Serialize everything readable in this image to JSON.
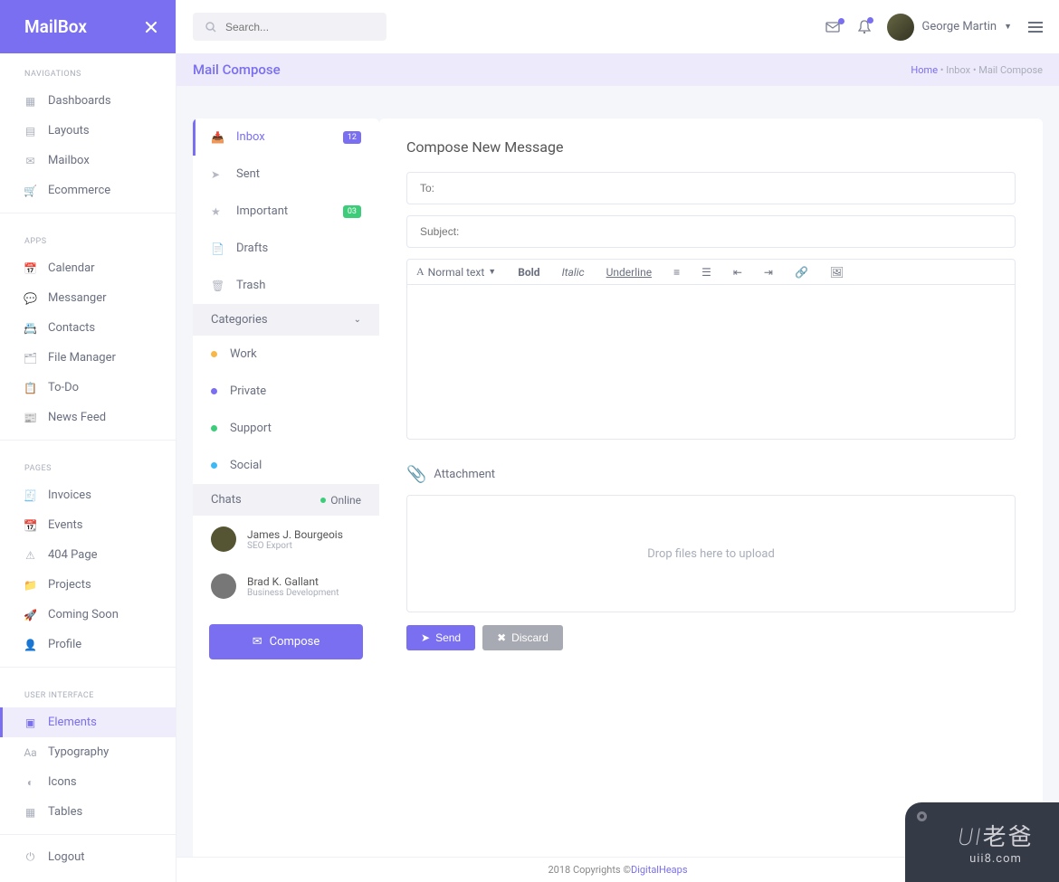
{
  "logo": "MailBox",
  "search": {
    "placeholder": "Search..."
  },
  "user": {
    "name": "George Martin"
  },
  "sidebar": {
    "sections": [
      {
        "title": "NAVIGATIONS",
        "items": [
          "Dashboards",
          "Layouts",
          "Mailbox",
          "Ecommerce"
        ]
      },
      {
        "title": "APPS",
        "items": [
          "Calendar",
          "Messanger",
          "Contacts",
          "File Manager",
          "To-Do",
          "News Feed"
        ]
      },
      {
        "title": "PAGES",
        "items": [
          "Invoices",
          "Events",
          "404 Page",
          "Projects",
          "Coming Soon",
          "Profile"
        ]
      },
      {
        "title": "USER INTERFACE",
        "items": [
          "Elements",
          "Typography",
          "Icons",
          "Tables"
        ]
      }
    ],
    "logout": "Logout"
  },
  "page": {
    "title": "Mail Compose",
    "crumbs": {
      "home": "Home",
      "mid": "Inbox",
      "last": "Mail Compose",
      "sep": "•"
    }
  },
  "mailFolders": [
    {
      "label": "Inbox",
      "badge": "12",
      "active": true
    },
    {
      "label": "Sent"
    },
    {
      "label": "Important",
      "badge": "03",
      "badgeClass": "green"
    },
    {
      "label": "Drafts"
    },
    {
      "label": "Trash"
    }
  ],
  "categoriesTitle": "Categories",
  "categories": [
    {
      "label": "Work",
      "color": "#f7b84b"
    },
    {
      "label": "Private",
      "color": "#7a6ff0"
    },
    {
      "label": "Support",
      "color": "#3dcc79"
    },
    {
      "label": "Social",
      "color": "#3db9f5"
    }
  ],
  "chats": {
    "title": "Chats",
    "status": "Online",
    "items": [
      {
        "name": "James J. Bourgeois",
        "role": "SEO Export"
      },
      {
        "name": "Brad K. Gallant",
        "role": "Business Development"
      }
    ]
  },
  "composeBtn": "Compose",
  "compose": {
    "title": "Compose New Message",
    "toPlaceholder": "To:",
    "subjectPlaceholder": "Subject:",
    "toolbar": {
      "normal": "Normal text",
      "bold": "Bold",
      "italic": "Italic",
      "underline": "Underline"
    },
    "attachment": "Attachment",
    "dropzone": "Drop files here to upload",
    "send": "Send",
    "discard": "Discard"
  },
  "footer": {
    "text": "2018 Copyrights © ",
    "link": "DigitalHeaps"
  },
  "watermark": {
    "top1": "UI",
    "top2": "老爸",
    "bottom": "uii8.com"
  }
}
